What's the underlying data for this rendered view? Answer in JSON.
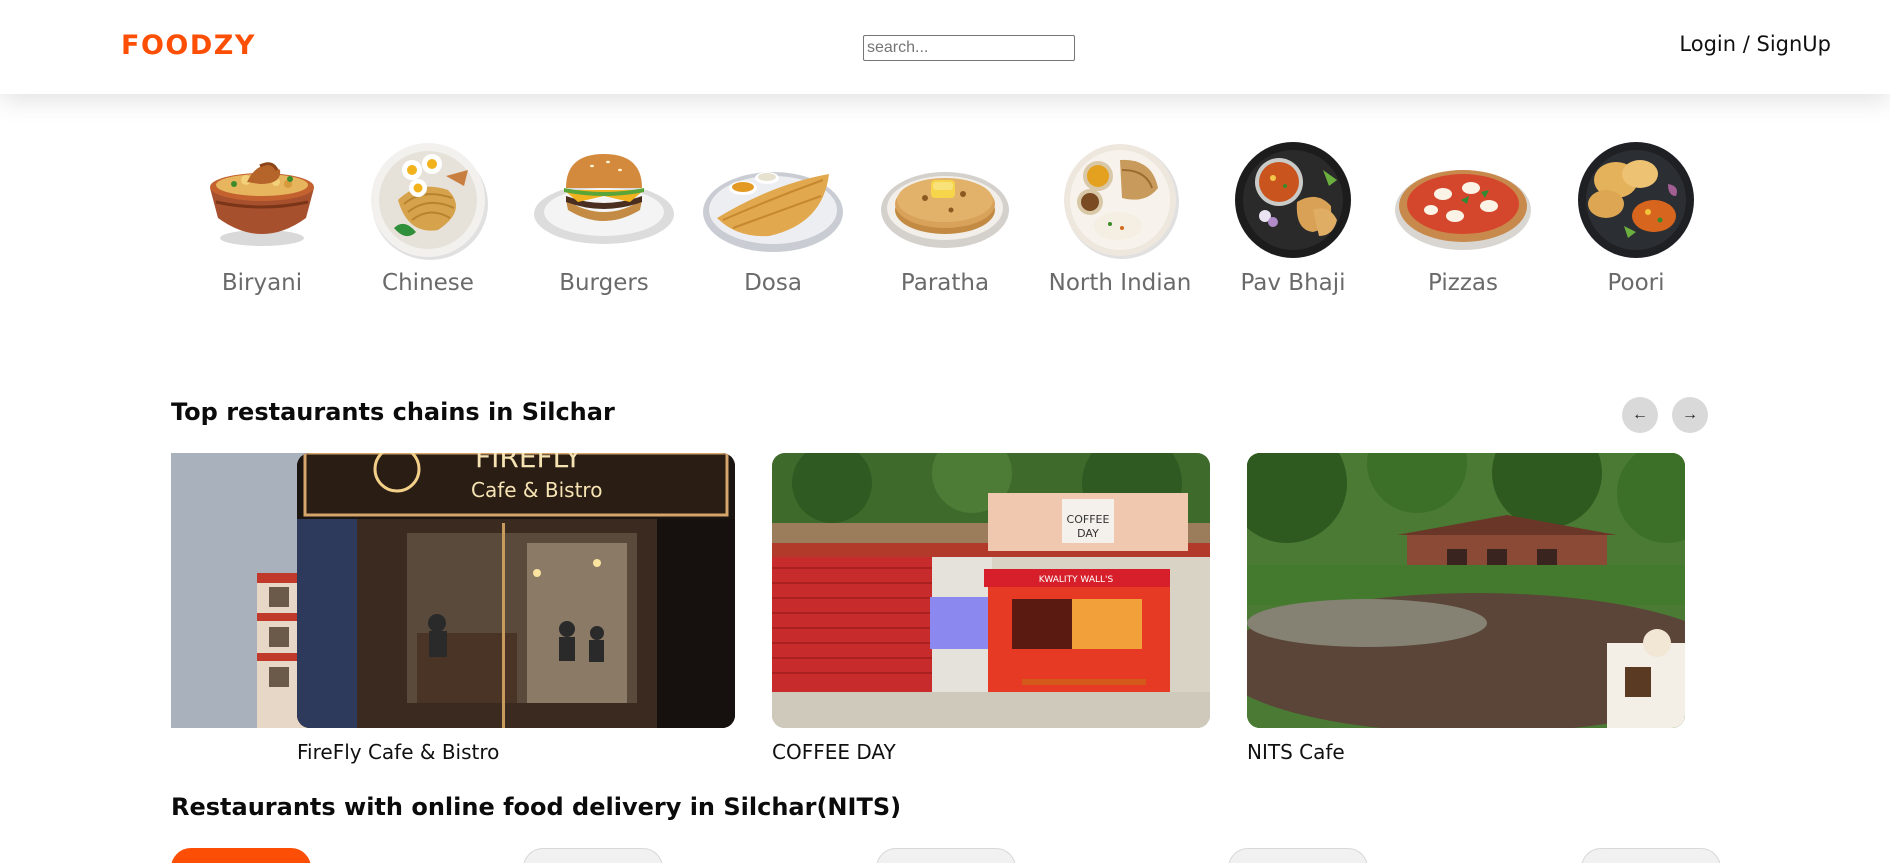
{
  "header": {
    "logo": "FOODZY",
    "search_placeholder": "search...",
    "login_label": "Login / SignUp"
  },
  "categories": [
    {
      "label": "Biryani",
      "icon": "biryani-bowl"
    },
    {
      "label": "Chinese",
      "icon": "noodles-plate"
    },
    {
      "label": "Burgers",
      "icon": "burger-plate"
    },
    {
      "label": "Dosa",
      "icon": "dosa-plate"
    },
    {
      "label": "Paratha",
      "icon": "paratha-plate"
    },
    {
      "label": "North Indian",
      "icon": "thali-plate"
    },
    {
      "label": "Pav Bhaji",
      "icon": "pav-bhaji-plate"
    },
    {
      "label": "Pizzas",
      "icon": "pizza-plate"
    },
    {
      "label": "Poori",
      "icon": "poori-plate"
    }
  ],
  "top_chains": {
    "title": "Top restaurants chains in Silchar",
    "prev_icon": "arrow-left-icon",
    "next_icon": "arrow-right-icon",
    "cards": [
      {
        "name": ""
      },
      {
        "name": "FireFly Cafe & Bistro",
        "sign_line1": "FIREFLY",
        "sign_line2": "Cafe & Bistro"
      },
      {
        "name": "COFFEE DAY",
        "sign_line1": "COFFEE",
        "sign_line2": "DAY",
        "banner": "KWALITY WALL'S"
      },
      {
        "name": "NITS Cafe"
      }
    ]
  },
  "online_delivery": {
    "title": "Restaurants with online food delivery in Silchar(NITS)"
  },
  "colors": {
    "brand": "#fc4f05",
    "category_label": "#6a6a6a"
  }
}
